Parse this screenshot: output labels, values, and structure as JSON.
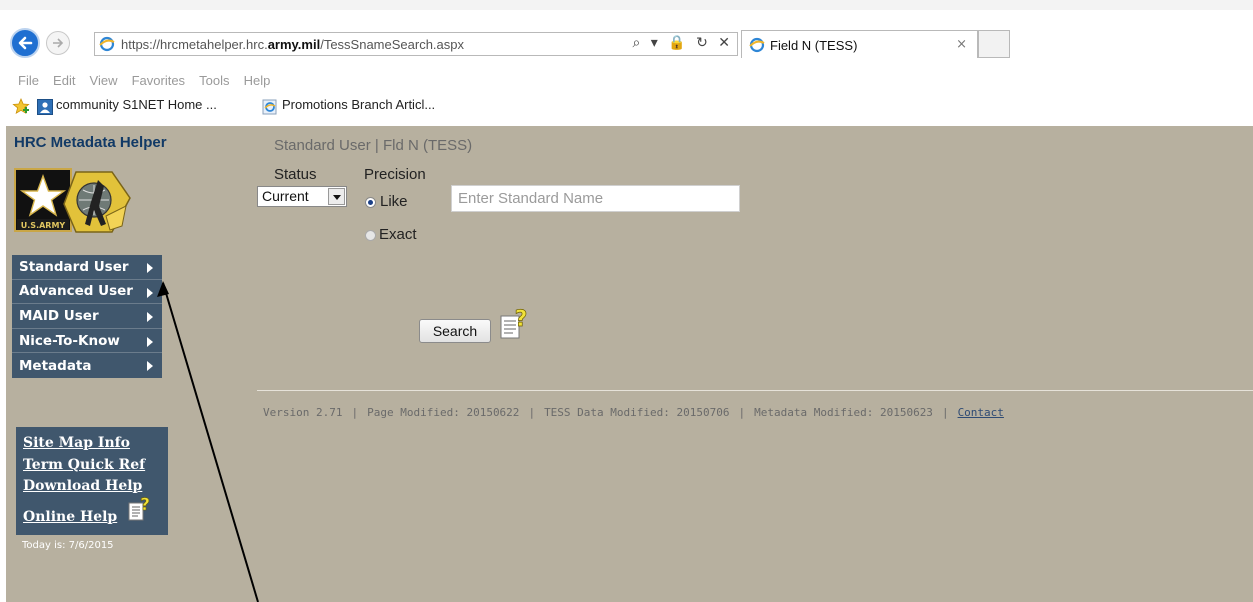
{
  "browser": {
    "address_url_prefix": "https://hrcmetahelper.hrc.",
    "address_url_domain": "army.mil",
    "address_url_path": "/TessSnameSearch.aspx",
    "tab_title": "Field N (TESS)",
    "tab_close": "×",
    "address_tools": "⌕ ▾ 🔒 ↻ ✕",
    "menu": [
      "File",
      "Edit",
      "View",
      "Favorites",
      "Tools",
      "Help"
    ],
    "favorites": [
      "community S1NET Home ...",
      "Promotions Branch Articl..."
    ]
  },
  "sidebar": {
    "title": "HRC Metadata Helper",
    "logo_text": "U.S.ARMY",
    "nav": [
      {
        "label": "Standard User"
      },
      {
        "label": "Advanced User"
      },
      {
        "label": "MAID User"
      },
      {
        "label": "Nice-To-Know"
      },
      {
        "label": "Metadata"
      }
    ],
    "help_links": [
      "Site Map Info",
      "Term Quick Ref",
      "Download Help",
      "Online Help"
    ],
    "today": "Today is: 7/6/2015"
  },
  "main": {
    "breadcrumb": "Standard User | Fld N (TESS)",
    "status_label": "Status",
    "precision_label": "Precision",
    "status_value": "Current",
    "radio_like_label": "Like",
    "radio_exact_label": "Exact",
    "radio_selected": "Like",
    "name_placeholder": "Enter Standard Name",
    "search_button": "Search"
  },
  "footer": {
    "version": "Version 2.71",
    "page_modified": "Page Modified: 20150622",
    "tess_modified": "TESS Data Modified: 20150706",
    "metadata_modified": "Metadata Modified: 20150623",
    "contact": "Contact"
  },
  "colors": {
    "page_bg": "#b7b09f",
    "nav_bg": "#40576d",
    "title_blue": "#123a66",
    "link_blue": "#2f4b74"
  }
}
